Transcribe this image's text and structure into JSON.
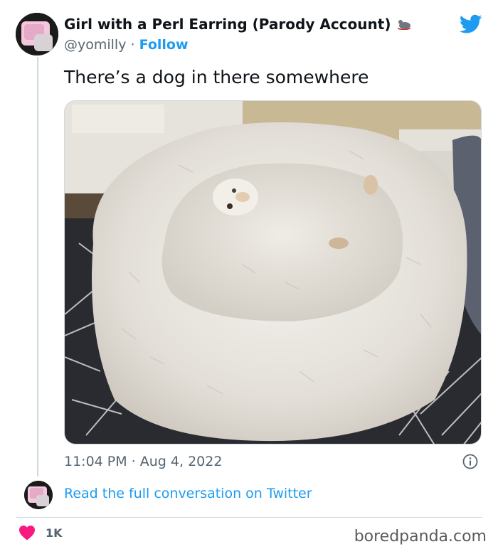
{
  "tweet": {
    "author_name": "Girl with a Perl Earring (Parody Account)",
    "handle": "@yomilly",
    "separator": "·",
    "follow_label": "Follow",
    "text": "There’s a dog in there somewhere",
    "timestamp": "11:04 PM · Aug 4, 2022",
    "read_full_label": "Read the full conversation on Twitter",
    "like_count": "1K"
  },
  "watermark": "boredpanda.com",
  "icons": {
    "platform": "twitter-bird-icon",
    "info": "info-icon",
    "like": "heart-icon",
    "badge": "mouse-icon"
  },
  "colors": {
    "link_blue": "#1d9bf0",
    "heart_pink": "#f91880",
    "secondary_text": "#536471"
  }
}
